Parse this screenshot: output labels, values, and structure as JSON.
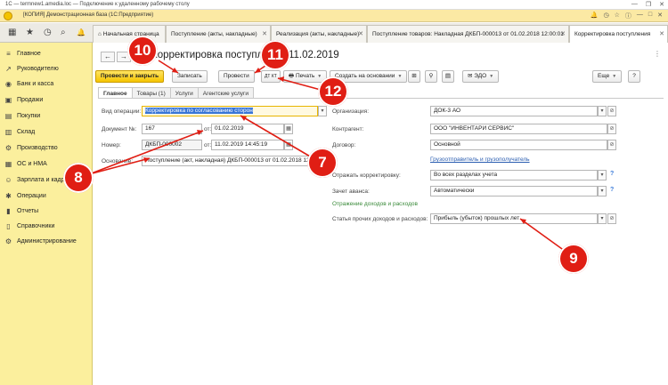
{
  "rdp": {
    "title": "1С — termnew1.amedia.loc — Подключение к удаленному рабочему столу",
    "minimize_glyph": "—",
    "restore_glyph": "❐",
    "close_glyph": "✕"
  },
  "app": {
    "title": "[КОПИЯ] Демонстрационная база (1С:Предприятие)"
  },
  "toolbar_icons": [
    {
      "name": "apps-grid-icon",
      "glyph": "▦"
    },
    {
      "name": "star-icon",
      "glyph": "★"
    },
    {
      "name": "history-icon",
      "glyph": "◷"
    },
    {
      "name": "search-icon",
      "glyph": "⌕"
    },
    {
      "name": "notification-icon",
      "glyph": "🔔"
    }
  ],
  "open_tabs": [
    {
      "label": "Начальная страница",
      "active": false
    },
    {
      "label": "Поступление (акты, накладные)",
      "active": false
    },
    {
      "label": "Реализация (акты, накладные)",
      "active": false
    },
    {
      "label": "Поступление товаров: Накладная ДКБП-000013 от 01.02.2018 12:00:01",
      "active": false
    },
    {
      "label": "Корректировка поступления",
      "active": true
    }
  ],
  "sidebar": {
    "items": [
      {
        "label": "Главное",
        "icon": "≡"
      },
      {
        "label": "Руководителю",
        "icon": "↗"
      },
      {
        "label": "Банк и касса",
        "icon": "◉"
      },
      {
        "label": "Продажи",
        "icon": "▣"
      },
      {
        "label": "Покупки",
        "icon": "▤"
      },
      {
        "label": "Склад",
        "icon": "▥"
      },
      {
        "label": "Производство",
        "icon": "⚙"
      },
      {
        "label": "ОС и НМА",
        "icon": "▦"
      },
      {
        "label": "Зарплата и кадры",
        "icon": "☺"
      },
      {
        "label": "Операции",
        "icon": "✱"
      },
      {
        "label": "Отчеты",
        "icon": "▮"
      },
      {
        "label": "Справочники",
        "icon": "▯"
      },
      {
        "label": "Администрирование",
        "icon": "⚙"
      }
    ]
  },
  "doc": {
    "title": "Корректировка поступления 11.02.2019",
    "back_glyph": "←",
    "forward_glyph": "→",
    "buttons": {
      "post_close": "Провести и закрыть",
      "save": "Записать",
      "post": "Провести",
      "dt_kt": "ДТ КТ",
      "print": "Печать",
      "create_based": "Создать на основании",
      "edo": "ЭДО"
    },
    "form_tabs": [
      "Главное",
      "Товары (1)",
      "Услуги",
      "Агентские услуги"
    ],
    "fields": {
      "op_type_label": "Вид операции:",
      "op_type_value": "Корректировка по согласованию сторон",
      "doc_no_label": "Документ №:",
      "doc_no_value": "167",
      "doc_date_from": "от:",
      "doc_date_value": "01.02.2019",
      "number_label": "Номер:",
      "number_value": "ДКБП-000002",
      "number_date_from": "от:",
      "number_date_value": "11.02.2019 14:45:19",
      "basis_label": "Основание:",
      "basis_value": "Поступление (акт, накладная) ДКБП-000013 от 01.02.2018 12:00:01",
      "org_label": "Организация:",
      "org_value": "ДОК-3 АО",
      "counterparty_label": "Контрагент:",
      "counterparty_value": "ООО \"ИНВЕНТАРИ СЕРВИС\"",
      "contract_label": "Договор:",
      "contract_value": "Основной",
      "shipper_link": "Грузоотправитель и грузополучатель",
      "reflect_label": "Отражать корректировку:",
      "reflect_value": "Во всех разделах учета",
      "advance_label": "Зачет аванса:",
      "advance_value": "Автоматически",
      "income_group": "Отражение доходов и расходов",
      "other_label": "Статья прочих доходов и расходов:",
      "other_value": "Прибыль (убыток) прошлых лет"
    }
  },
  "callouts": [
    "10",
    "11",
    "12",
    "8",
    "7",
    "9"
  ]
}
